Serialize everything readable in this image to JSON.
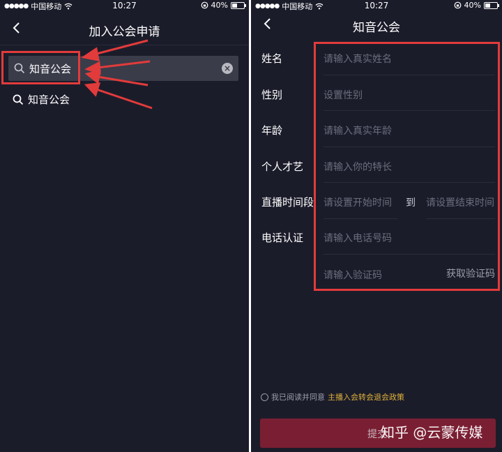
{
  "status_bar": {
    "signal_dots": "●●●●●",
    "carrier": "中国移动",
    "time": "10:27",
    "battery_percent": "40%"
  },
  "left_screen": {
    "title": "加入公会申请",
    "search_value": "知音公会",
    "suggestion": "知音公会"
  },
  "right_screen": {
    "title": "知音公会",
    "fields": {
      "name": {
        "label": "姓名",
        "placeholder": "请输入真实姓名"
      },
      "gender": {
        "label": "性别",
        "placeholder": "设置性别"
      },
      "age": {
        "label": "年龄",
        "placeholder": "请输入真实年龄"
      },
      "talent": {
        "label": "个人才艺",
        "placeholder": "请输入你的特长"
      },
      "live_period": {
        "label": "直播时间段",
        "start_placeholder": "请设置开始时间",
        "to": "到",
        "end_placeholder": "请设置结束时间"
      },
      "phone": {
        "label": "电话认证",
        "placeholder": "请输入电话号码"
      },
      "code": {
        "placeholder": "请输入验证码",
        "get_code": "获取验证码"
      }
    },
    "agreement": {
      "prefix": "我已阅读并同意",
      "policy": "主播入会转会退会政策"
    },
    "submit_label": "提交",
    "watermark": "知乎 @云蒙传媒"
  },
  "colors": {
    "background": "#1b1c2a",
    "highlight": "#e23b3b",
    "policy_link": "#e0b23a",
    "submit": "#7a1f33"
  }
}
